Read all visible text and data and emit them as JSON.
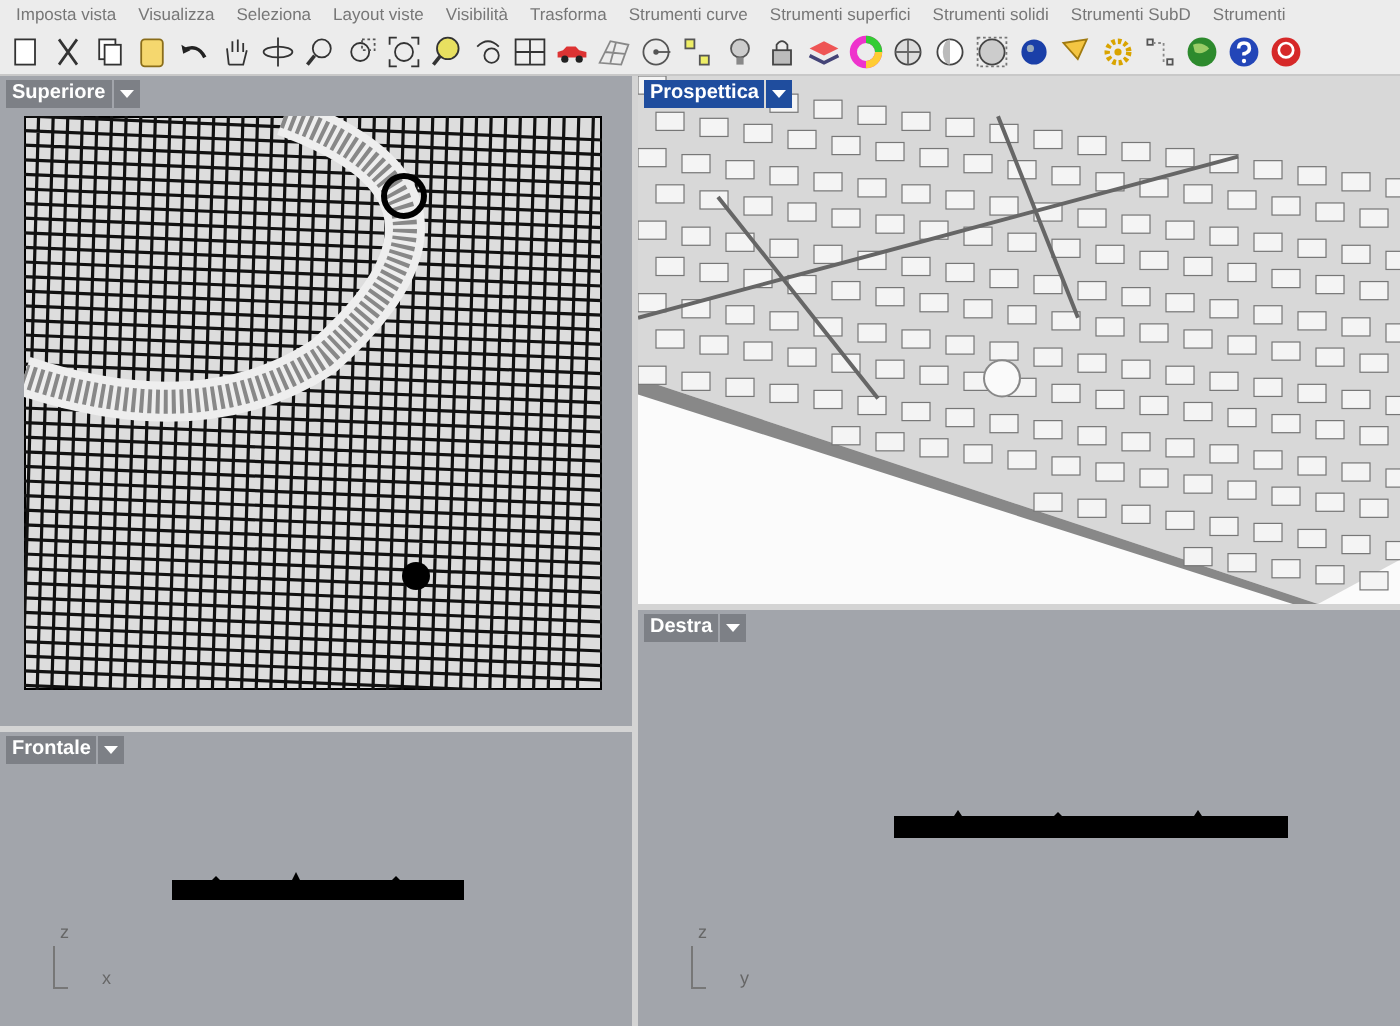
{
  "menu_tabs": [
    "Imposta vista",
    "Visualizza",
    "Seleziona",
    "Layout viste",
    "Visibilità",
    "Trasforma",
    "Strumenti curve",
    "Strumenti superfici",
    "Strumenti solidi",
    "Strumenti SubD",
    "Strumenti"
  ],
  "viewports": [
    {
      "title": "Superiore",
      "selected": false,
      "kind": "top"
    },
    {
      "title": "Frontale",
      "selected": false,
      "kind": "front",
      "axes": [
        "z",
        "x"
      ]
    },
    {
      "title": "Prospettica",
      "selected": true,
      "kind": "perspective"
    },
    {
      "title": "Destra",
      "selected": false,
      "kind": "right",
      "axes": [
        "z",
        "y"
      ]
    }
  ]
}
